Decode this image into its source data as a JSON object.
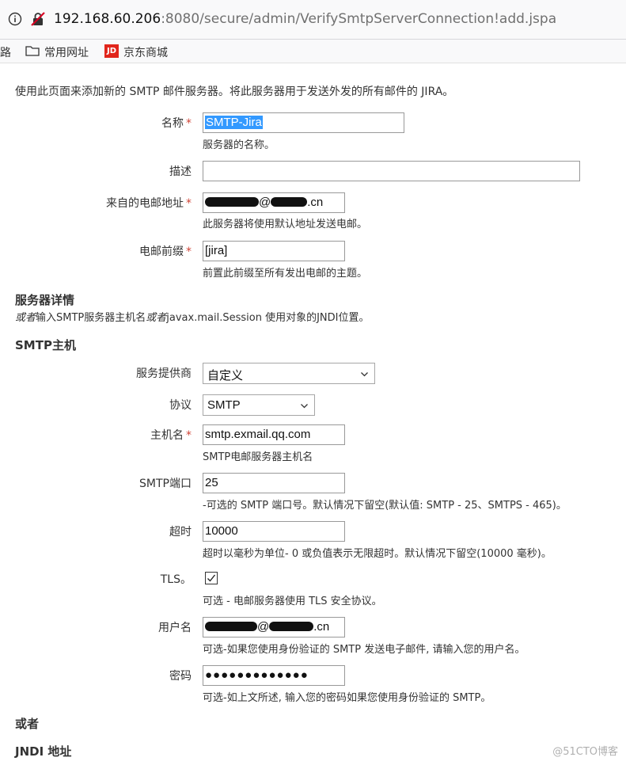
{
  "browser": {
    "url_host": "192.168.60.206",
    "url_path": ":8080/secure/admin/VerifySmtpServerConnection!add.jspa",
    "bookmarks": [
      "路",
      "常用网址",
      "京东商城"
    ],
    "jd_logo": "JD"
  },
  "intro": "使用此页面来添加新的 SMTP 邮件服务器。将此服务器用于发送外发的所有邮件的 JIRA。",
  "required_mark": "*",
  "form": {
    "name_label": "名称",
    "name_value": "SMTP-Jira",
    "name_hint": "服务器的名称。",
    "desc_label": "描述",
    "desc_value": "",
    "from_label": "来自的电邮地址",
    "from_value_visible_suffix": ".cn",
    "from_value_at": "@",
    "from_hint": "此服务器将使用默认地址发送电邮。",
    "prefix_label": "电邮前缀",
    "prefix_value": "[jira]",
    "prefix_hint": "前置此前缀至所有发出电邮的主题。"
  },
  "server_details": {
    "title": "服务器详情",
    "note_or1": "或者",
    "note_mid": "输入SMTP服务器主机名",
    "note_or2": "或者",
    "note_end": "javax.mail.Session 使用对象的JNDI位置。"
  },
  "smtp_host": {
    "title": "SMTP主机",
    "provider_label": "服务提供商",
    "provider_value": "自定义",
    "protocol_label": "协议",
    "protocol_value": "SMTP",
    "host_label": "主机名",
    "host_value": "smtp.exmail.qq.com",
    "host_hint": "SMTP电邮服务器主机名",
    "port_label": "SMTP端口",
    "port_value": "25",
    "port_hint": "-可选的 SMTP 端口号。默认情况下留空(默认值: SMTP - 25、SMTPS - 465)。",
    "timeout_label": "超时",
    "timeout_value": "10000",
    "timeout_hint": "超时以毫秒为单位- 0 或负值表示无限超时。默认情况下留空(10000 毫秒)。",
    "tls_label": "TLS。",
    "tls_checked": true,
    "tls_hint": "可选 - 电邮服务器使用 TLS 安全协议。",
    "user_label": "用户名",
    "user_value_at": "@",
    "user_value_visible_suffix": ".cn",
    "user_hint": "可选-如果您使用身份验证的 SMTP 发送电子邮件, 请输入您的用户名。",
    "password_label": "密码",
    "password_value": "●●●●●●●●●●●●●",
    "password_hint": "可选-如上文所述, 输入您的密码如果您使用身份验证的 SMTP。"
  },
  "or_label": "或者",
  "jndi_title": "JNDI 地址",
  "watermark": "@51CTO博客"
}
